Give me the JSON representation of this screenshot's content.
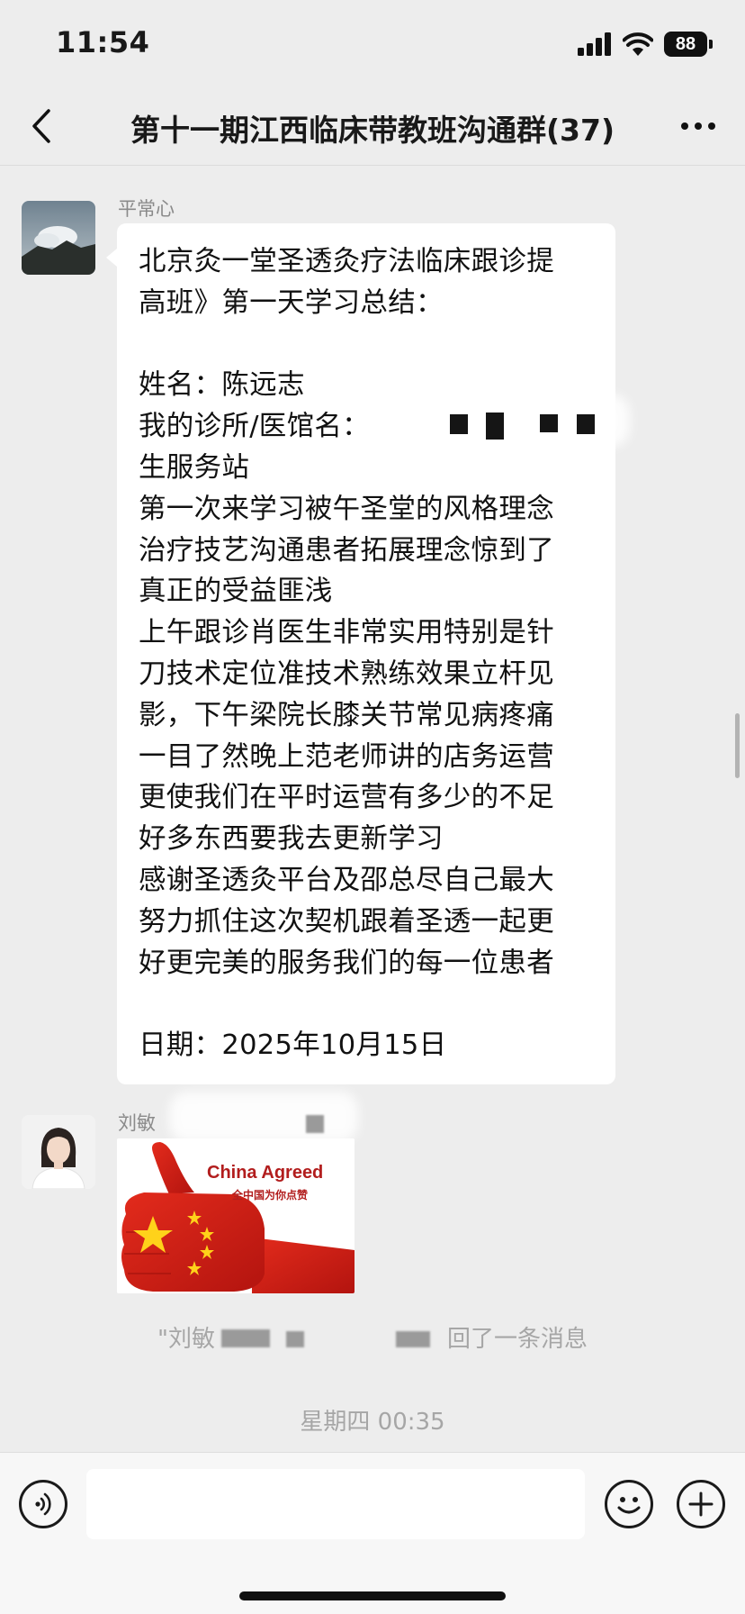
{
  "status": {
    "time": "11:54",
    "battery": "88"
  },
  "nav": {
    "title": "第十一期江西临床带教班沟通群(37)"
  },
  "messages": [
    {
      "sender": "平常心",
      "lines": [
        "北京灸一堂圣透灸疗法临床跟诊提",
        "高班》第一天学习总结：",
        "",
        "姓名：陈远志",
        "我的诊所/医馆名：",
        "生服务站",
        "第一次来学习被午圣堂的风格理念",
        "治疗技艺沟通患者拓展理念惊到了",
        "真正的受益匪浅",
        "上午跟诊肖医生非常实用特别是针",
        "刀技术定位准技术熟练效果立杆见",
        "影，下午梁院长膝关节常见病疼痛",
        "一目了然晚上范老师讲的店务运营",
        "更使我们在平时运营有多少的不足",
        "好多东西要我去更新学习",
        "感谢圣透灸平台及邵总尽自己最大",
        "努力抓住这次契机跟着圣透一起更",
        "好更完美的服务我们的每一位患者",
        "",
        "日期：2025年10月15日"
      ]
    },
    {
      "sender": "刘敏",
      "image": {
        "caption_en": "China Agreed",
        "caption_cn": "全中国为你点赞"
      }
    }
  ],
  "system": {
    "recall_prefix": "\"刘敏",
    "recall_suffix": "回了一条消息",
    "timestamp": "星期四 00:35"
  },
  "input": {
    "placeholder": ""
  }
}
